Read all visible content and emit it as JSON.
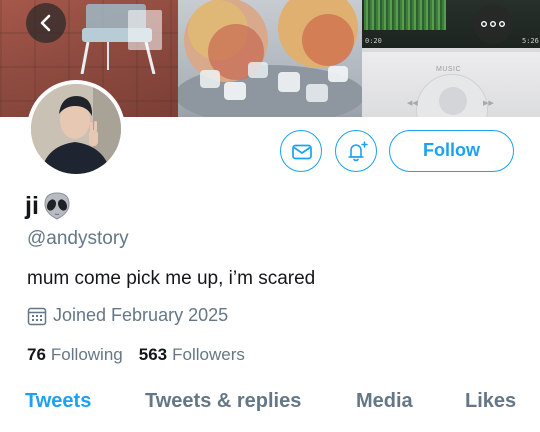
{
  "header": {
    "back_icon": "chevron-left-icon",
    "more_icon": "more-horizontal-icon",
    "banner": {
      "player": {
        "time_elapsed": "0:20",
        "time_total": "5:26",
        "music_label": "MUSIC",
        "prev_icon": "◀◀",
        "next_icon": "▶▶"
      }
    }
  },
  "actions": {
    "message_icon": "mail-icon",
    "notify_icon": "bell-plus-icon",
    "follow_label": "Follow"
  },
  "profile": {
    "display_name": "ji",
    "name_emoji": "alien-icon",
    "handle": "@andystory",
    "bio": "mum come pick me up, i’m scared",
    "joined_icon": "calendar-icon",
    "joined": "Joined February 2025",
    "following_count": "76",
    "following_label": "Following",
    "followers_count": "563",
    "followers_label": "Followers"
  },
  "tabs": [
    {
      "label": "Tweets",
      "active": true
    },
    {
      "label": "Tweets & replies",
      "active": false
    },
    {
      "label": "Media",
      "active": false
    },
    {
      "label": "Likes",
      "active": false
    }
  ],
  "colors": {
    "accent": "#1da1f2",
    "secondary_text": "#657786",
    "primary_text": "#14171a"
  }
}
